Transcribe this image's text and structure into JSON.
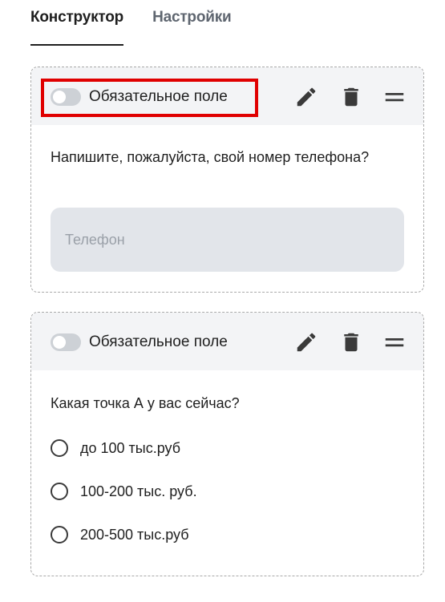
{
  "tabs": [
    {
      "label": "Конструктор",
      "active": true
    },
    {
      "label": "Настройки",
      "active": false
    }
  ],
  "cards": [
    {
      "required_label": "Обязательное поле",
      "required_on": false,
      "highlighted": true,
      "question": "Напишите, пожалуйста, свой номер телефона?",
      "input": {
        "placeholder": "Телефон",
        "value": ""
      }
    },
    {
      "required_label": "Обязательное поле",
      "required_on": false,
      "highlighted": false,
      "question": "Какая точка А у вас сейчас?",
      "options": [
        "до 100 тыс.руб",
        "100-200 тыс. руб.",
        "200-500 тыс.руб"
      ]
    }
  ],
  "icons": {
    "edit": "pencil-icon",
    "delete": "trash-icon",
    "drag": "drag-handle-icon"
  },
  "colors": {
    "highlight": "#e00000",
    "card_header": "#f3f4f6",
    "input_bg": "#e2e5ea",
    "toggle_off": "#cdd1d6"
  }
}
